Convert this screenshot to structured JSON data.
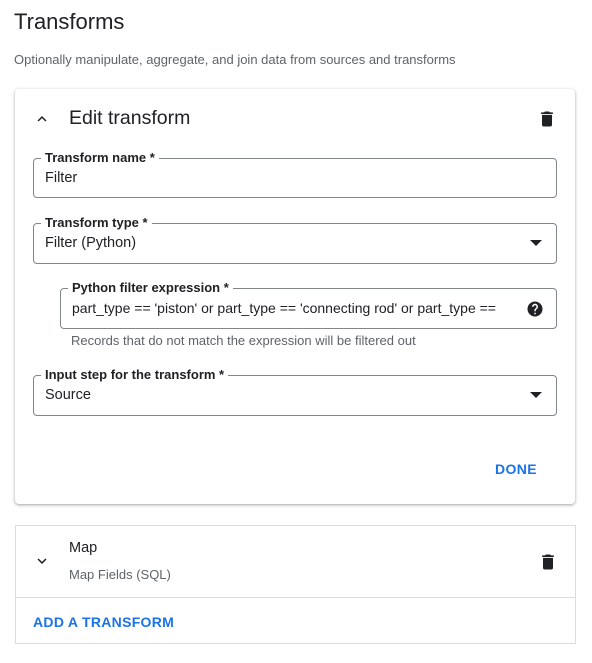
{
  "page": {
    "title": "Transforms",
    "subtitle": "Optionally manipulate, aggregate, and join data from sources and transforms"
  },
  "edit_card": {
    "title": "Edit transform",
    "collapse_icon": "chevron-up-icon",
    "delete_icon": "trash-icon",
    "fields": {
      "name": {
        "label": "Transform name *",
        "value": "Filter"
      },
      "type": {
        "label": "Transform type *",
        "value": "Filter (Python)"
      },
      "expression": {
        "label": "Python filter expression *",
        "value": "part_type == 'piston' or part_type == 'connecting rod' or part_type ==",
        "help_icon": "help-circle-icon",
        "hint": "Records that do not match the expression will be filtered out"
      },
      "input_step": {
        "label": "Input step for the transform *",
        "value": "Source"
      }
    },
    "done_label": "DONE"
  },
  "transforms_list": [
    {
      "title": "Map",
      "subtitle": "Map Fields (SQL)",
      "expand_icon": "chevron-down-icon",
      "delete_icon": "trash-icon"
    }
  ],
  "add_transform_label": "ADD A TRANSFORM",
  "colors": {
    "accent": "#1a73e8",
    "text": "#202124",
    "secondary_text": "#5f6368",
    "border": "#80868b",
    "divider": "#dadce0"
  }
}
